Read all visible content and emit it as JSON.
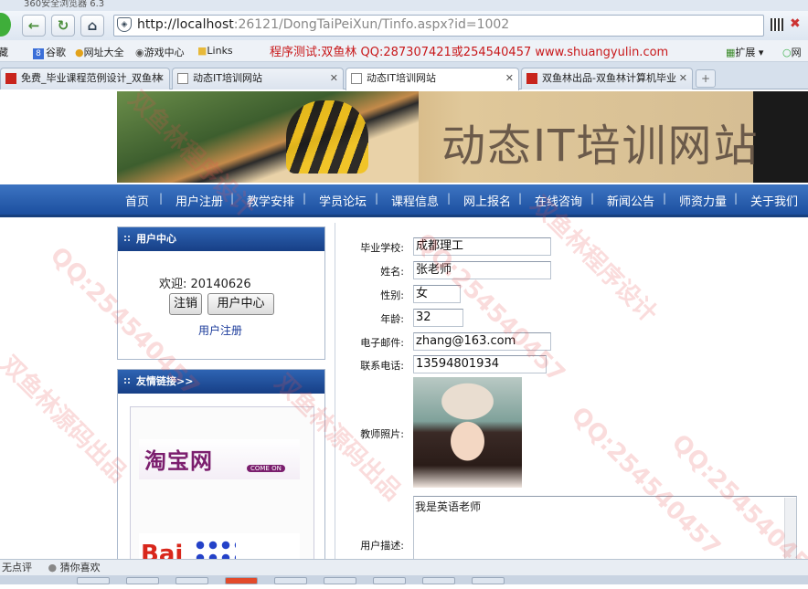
{
  "browser": {
    "title": "360安全浏览器 6.3",
    "url_host": "http://localhost",
    "url_rest": ":26121/DongTaiPeiXun/Tinfo.aspx?id=1002",
    "favorites": [
      "藏",
      "谷歌",
      "网址大全",
      "游戏中心",
      "Links"
    ],
    "promo": "程序测试:双鱼林 QQ:287307421或254540457 www.shuangyulin.com",
    "extensions": [
      "扩展",
      "网"
    ],
    "tabs": [
      {
        "label": "免费_毕业课程范例设计_双鱼林",
        "active": false
      },
      {
        "label": "动态IT培训网站",
        "active": false
      },
      {
        "label": "动态IT培训网站",
        "active": true
      },
      {
        "label": "双鱼林出品-双鱼林计算机毕业",
        "active": false
      }
    ],
    "new_tab": "+",
    "status_left": "无点评",
    "status_right": "猜你喜欢"
  },
  "site": {
    "banner_title": "动态IT培训网站",
    "menu": [
      "首页",
      "用户注册",
      "教学安排",
      "学员论坛",
      "课程信息",
      "网上报名",
      "在线咨询",
      "新闻公告",
      "师资力量",
      "关于我们"
    ]
  },
  "user_center": {
    "title": "用户中心",
    "welcome": "欢迎: 20140626",
    "logout": "注销",
    "center": "用户中心",
    "register": "用户注册"
  },
  "friend_links": {
    "title": "友情链接>>",
    "taobao": "淘宝网",
    "taobao_tag": "COME ON",
    "baidu": "Bai"
  },
  "teacher": {
    "school_label": "毕业学校:",
    "school": "成都理工",
    "name_label": "姓名:",
    "name": "张老师",
    "gender_label": "性别:",
    "gender": "女",
    "age_label": "年龄:",
    "age": "32",
    "email_label": "电子邮件:",
    "email": "zhang@163.com",
    "phone_label": "联系电话:",
    "phone": "13594801934",
    "photo_label": "教师照片:",
    "desc_label": "用户描述:",
    "desc": "我是英语老师"
  },
  "watermarks": [
    "QQ:254540457",
    "双鱼林源码出品",
    "QQ:254540457",
    "双鱼林程序设计",
    "QQ:254540457",
    "双鱼林源码出品",
    "双鱼林程序设计",
    "QQ:254540457"
  ]
}
